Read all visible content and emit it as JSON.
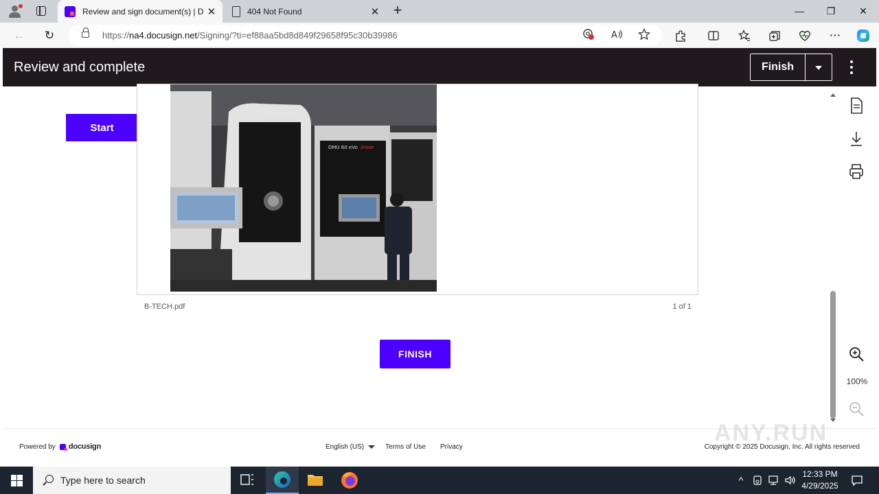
{
  "browser": {
    "tabs": [
      {
        "title": "Review and sign document(s) | D",
        "active": true
      },
      {
        "title": "404 Not Found",
        "active": false
      }
    ],
    "new_tab_symbol": "+",
    "window_controls": {
      "minimize": "—",
      "restore": "❐",
      "close": "✕"
    },
    "address": {
      "scheme": "https://",
      "host": "na4.docusign.net",
      "path": "/Signing/?ti=ef88aa5bd8d849f29658f95c30b39986"
    },
    "icons": [
      "back-icon",
      "refresh-icon",
      "lock-icon",
      "tracking-prevention-icon",
      "read-aloud-icon",
      "favorite-icon",
      "extensions-icon",
      "split-screen-icon",
      "favorites-icon",
      "collections-icon",
      "browser-essentials-icon",
      "more-icon",
      "copilot-icon"
    ]
  },
  "header": {
    "title": "Review and complete",
    "finish_label": "Finish"
  },
  "document": {
    "start_label": "Start",
    "file_name": "B-TECH.pdf",
    "page_count": "1 of 1",
    "finish_label": "FINISH",
    "photo_text": {
      "machine1": "DMU 60 eVo",
      "machine2": "DMU 60 eVo",
      "machine2_brand": "linear"
    },
    "zoom": "100%"
  },
  "footer": {
    "powered_by": "Powered by",
    "brand": "docusign",
    "language": "English (US)",
    "terms": "Terms of Use",
    "privacy": "Privacy",
    "copyright": "Copyright © 2025 Docusign, Inc. All rights reserved"
  },
  "watermark": "ANY.RUN",
  "taskbar": {
    "search_placeholder": "Type here to search",
    "time": "12:33 PM",
    "date": "4/29/2025"
  },
  "colors": {
    "brand_purple": "#4c00ff",
    "header_bg": "#1e1a1d",
    "taskbar_bg": "#1c2430"
  }
}
